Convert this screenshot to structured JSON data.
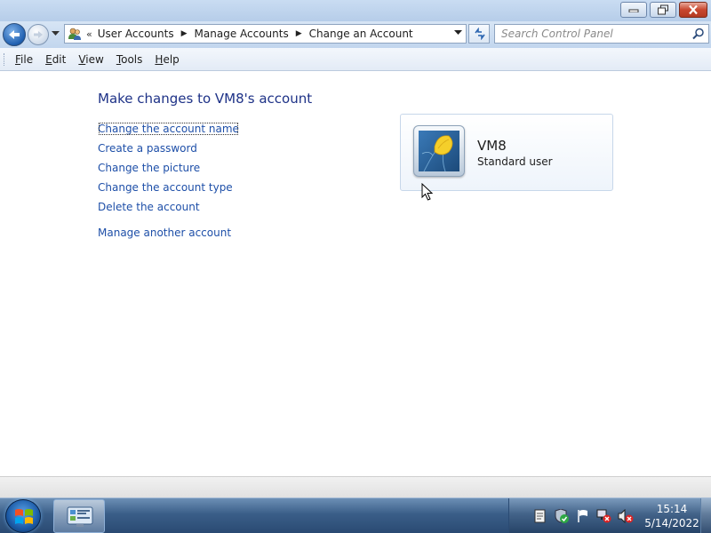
{
  "window": {
    "minimize_icon": "minimize-icon",
    "maximize_icon": "restore-icon",
    "close_icon": "close-icon"
  },
  "address_bar": {
    "overflow": "«",
    "breadcrumbs": [
      "User Accounts",
      "Manage Accounts",
      "Change an Account"
    ],
    "icon": "control-panel-users-icon"
  },
  "search": {
    "placeholder": "Search Control Panel"
  },
  "menu": {
    "items": [
      {
        "accel": "F",
        "rest": "ile"
      },
      {
        "accel": "E",
        "rest": "dit"
      },
      {
        "accel": "V",
        "rest": "iew"
      },
      {
        "accel": "T",
        "rest": "ools"
      },
      {
        "accel": "H",
        "rest": "elp"
      }
    ]
  },
  "main": {
    "title": "Make changes to VM8's account",
    "tasks": [
      "Change the account name",
      "Create a password",
      "Change the picture",
      "Change the account type",
      "Delete the account"
    ],
    "other_task": "Manage another account"
  },
  "account": {
    "name": "VM8",
    "type": "Standard user",
    "picture": "yellow-flower-picture"
  },
  "taskbar": {
    "time": "15:14",
    "date": "5/14/2022"
  },
  "colors": {
    "link": "#1e4fa8",
    "title": "#1e3287",
    "taskbar": "#3a5e88"
  }
}
